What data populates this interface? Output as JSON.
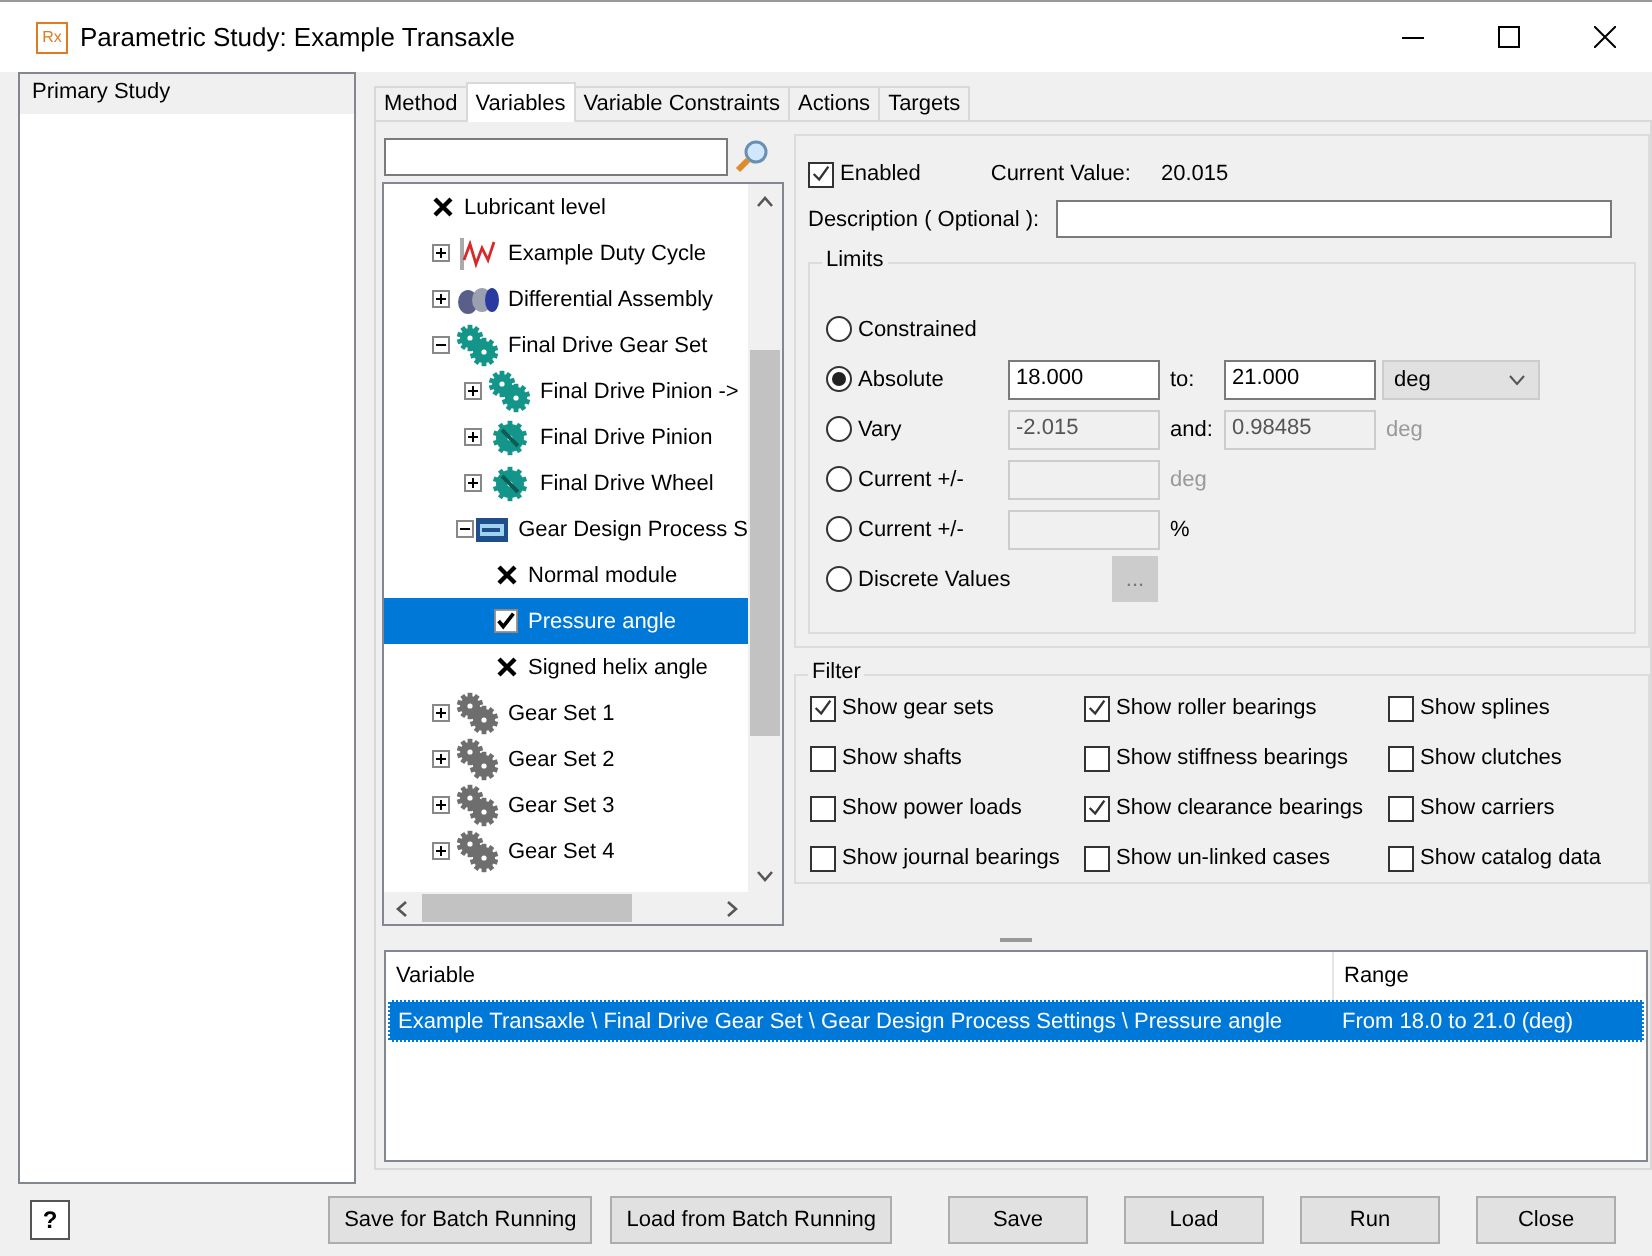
{
  "window": {
    "logo": "Rx",
    "title": "Parametric Study: Example Transaxle"
  },
  "studies": [
    {
      "label": "Primary Study",
      "selected": true
    }
  ],
  "tabs": [
    {
      "label": "Method",
      "selected": false
    },
    {
      "label": "Variables",
      "selected": true
    },
    {
      "label": "Variable Constraints",
      "selected": false
    },
    {
      "label": "Actions",
      "selected": false
    },
    {
      "label": "Targets",
      "selected": false
    }
  ],
  "tree": {
    "items": [
      {
        "kind": "variable",
        "label": "Lubricant level",
        "checked": false,
        "selected": false
      },
      {
        "kind": "cycle",
        "label": "Example Duty Cycle",
        "expanded": false,
        "selected": false
      },
      {
        "kind": "assembly",
        "label": "Differential Assembly",
        "expanded": false,
        "selected": false
      },
      {
        "kind": "gearset",
        "color": "#14958a",
        "label": "Final Drive Gear Set",
        "expanded": true,
        "selected": false,
        "children": [
          {
            "kind": "gearset",
            "color": "#14958a",
            "label": "Final Drive Pinion ->",
            "expanded": false,
            "selected": false
          },
          {
            "kind": "gear",
            "label": "Final Drive Pinion",
            "expanded": false,
            "selected": false
          },
          {
            "kind": "gear",
            "label": "Final Drive Wheel",
            "expanded": false,
            "selected": false
          },
          {
            "kind": "settings",
            "label": "Gear Design Process S",
            "expanded": true,
            "selected": false,
            "children": [
              {
                "kind": "variable",
                "label": "Normal module",
                "checked": false,
                "selected": false
              },
              {
                "kind": "variable",
                "label": "Pressure angle",
                "checked": true,
                "selected": true
              },
              {
                "kind": "variable",
                "label": "Signed helix angle",
                "checked": false,
                "selected": false
              }
            ]
          }
        ]
      },
      {
        "kind": "gearset",
        "color": "#6e6e6e",
        "label": "Gear Set 1",
        "expanded": false,
        "selected": false
      },
      {
        "kind": "gearset",
        "color": "#6e6e6e",
        "label": "Gear Set 2",
        "expanded": false,
        "selected": false
      },
      {
        "kind": "gearset",
        "color": "#6e6e6e",
        "label": "Gear Set 3",
        "expanded": false,
        "selected": false
      },
      {
        "kind": "gearset",
        "color": "#6e6e6e",
        "label": "Gear Set 4",
        "expanded": false,
        "selected": false
      }
    ]
  },
  "variable": {
    "enabled": true,
    "enabled_label": "Enabled",
    "current_value_label": "Current Value:",
    "current_value": "20.015",
    "description_label": "Description ( Optional ):"
  },
  "limits": {
    "title": "Limits",
    "options": [
      {
        "label": "Constrained",
        "selected": false
      },
      {
        "label": "Absolute",
        "selected": true,
        "fields": [
          {
            "value": "18.000",
            "disabled": false
          },
          {
            "value": "21.000",
            "disabled": false
          }
        ],
        "separator": "to:",
        "unit": {
          "kind": "dropdown",
          "text": "deg",
          "disabled": false
        }
      },
      {
        "label": "Vary",
        "selected": false,
        "fields": [
          {
            "value": "-2.015",
            "disabled": true
          },
          {
            "value": "0.98485",
            "disabled": true
          }
        ],
        "separator": "and:",
        "unit": {
          "kind": "text",
          "text": "deg",
          "disabled": true
        }
      },
      {
        "label": "Current +/-",
        "selected": false,
        "fields": [
          {
            "disabled": true
          }
        ],
        "unit": {
          "kind": "text",
          "text": "deg",
          "disabled": true
        }
      },
      {
        "label": "Current +/-",
        "selected": false,
        "fields": [
          {
            "disabled": true
          }
        ],
        "unit": {
          "kind": "text",
          "text": "%",
          "disabled": false
        }
      },
      {
        "label": "Discrete Values",
        "selected": false,
        "button": {
          "text": "...",
          "disabled": true
        }
      }
    ]
  },
  "filter": {
    "title": "Filter",
    "options": [
      {
        "label": "Show gear sets",
        "checked": true
      },
      {
        "label": "Show roller bearings",
        "checked": true
      },
      {
        "label": "Show splines",
        "checked": false
      },
      {
        "label": "Show shafts",
        "checked": false
      },
      {
        "label": "Show stiffness bearings",
        "checked": false
      },
      {
        "label": "Show clutches",
        "checked": false
      },
      {
        "label": "Show power loads",
        "checked": false
      },
      {
        "label": "Show clearance bearings",
        "checked": true
      },
      {
        "label": "Show carriers",
        "checked": false
      },
      {
        "label": "Show journal bearings",
        "checked": false
      },
      {
        "label": "Show un-linked cases",
        "checked": false
      },
      {
        "label": "Show catalog data",
        "checked": false
      }
    ]
  },
  "variables_table": {
    "columns": [
      "Variable",
      "Range"
    ],
    "rows": [
      {
        "cells": [
          "Example Transaxle \\ Final Drive Gear Set \\ Gear Design Process Settings \\ Pressure angle",
          "From 18.0 to 21.0 (deg)"
        ],
        "selected": true
      }
    ]
  },
  "help": "?",
  "buttons_left": [
    "Save for Batch Running",
    "Load from Batch Running"
  ],
  "buttons_right": [
    "Save",
    "Load",
    "Run",
    "Close"
  ]
}
